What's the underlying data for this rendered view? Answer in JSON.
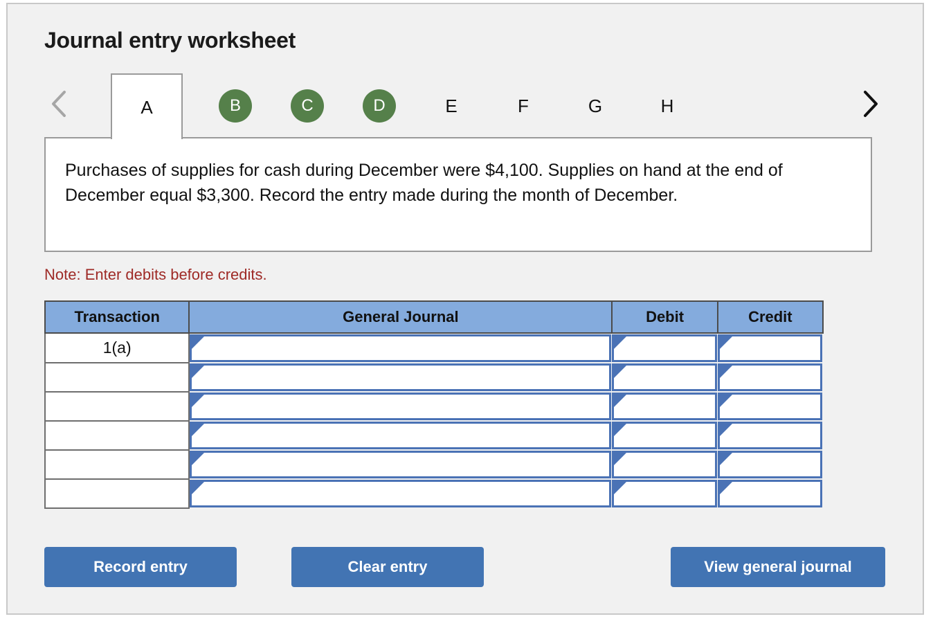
{
  "page_title": "Journal entry worksheet",
  "nav": {
    "prev_icon": "chevron-left-icon",
    "next_icon": "chevron-right-icon"
  },
  "tabs": [
    {
      "label": "A",
      "style": "active"
    },
    {
      "label": "B",
      "style": "completed"
    },
    {
      "label": "C",
      "style": "completed"
    },
    {
      "label": "D",
      "style": "completed"
    },
    {
      "label": "E",
      "style": "plain"
    },
    {
      "label": "F",
      "style": "plain"
    },
    {
      "label": "G",
      "style": "plain"
    },
    {
      "label": "H",
      "style": "plain"
    }
  ],
  "description": "Purchases of supplies for cash during December were $4,100. Supplies on hand at the end of December equal $3,300. Record the entry made during the month of December.",
  "note": "Note: Enter debits before credits.",
  "table": {
    "headers": {
      "transaction": "Transaction",
      "general_journal": "General Journal",
      "debit": "Debit",
      "credit": "Credit"
    },
    "rows": [
      {
        "transaction": "1(a)",
        "general_journal": "",
        "debit": "",
        "credit": ""
      },
      {
        "transaction": "",
        "general_journal": "",
        "debit": "",
        "credit": ""
      },
      {
        "transaction": "",
        "general_journal": "",
        "debit": "",
        "credit": ""
      },
      {
        "transaction": "",
        "general_journal": "",
        "debit": "",
        "credit": ""
      },
      {
        "transaction": "",
        "general_journal": "",
        "debit": "",
        "credit": ""
      },
      {
        "transaction": "",
        "general_journal": "",
        "debit": "",
        "credit": ""
      }
    ]
  },
  "buttons": {
    "record": "Record entry",
    "clear": "Clear entry",
    "view": "View general journal"
  },
  "colors": {
    "page_background": "#f1f1f1",
    "tab_completed": "#55804a",
    "note_text": "#9e2a26",
    "table_header": "#84abdd",
    "input_border": "#4a72b5",
    "button": "#4274b3"
  }
}
